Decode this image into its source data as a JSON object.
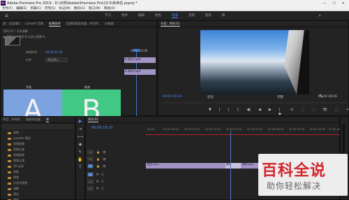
{
  "titlebar": {
    "app_icon": "Pr",
    "title": "Adobe Premiere Pro 2019 - D:\\示例\\Adobe\\Premiere Pro\\13.0\\未命名.prproj *",
    "controls": [
      "—",
      "☐",
      "✕"
    ]
  },
  "menubar": {
    "items": [
      "文件(F)",
      "编辑(E)",
      "剪辑(C)",
      "序列(S)",
      "标记(M)",
      "图形(G)",
      "窗口(W)",
      "帮助(H)"
    ]
  },
  "workspace": {
    "home_icon": "home-icon",
    "tabs": [
      "学习",
      "组件",
      "编辑",
      "颜色",
      "效果",
      "音频",
      "图形",
      "库"
    ],
    "active_tab": "效果",
    "more": "»"
  },
  "effect_panel": {
    "tabs": [
      "源：(无剪辑)",
      "Lumetri 范围",
      "效果控件",
      "音频剪辑混合器：序列01",
      "元数据"
    ],
    "active_tab": "效果控件",
    "crumb": "序列 01 * 交叉溶解",
    "hint": "▶ 图像 A 卷曲到 B 以显示图像 B。",
    "duration_label": "持续时间",
    "duration_value": "00:00:01:00",
    "align_label": "对齐",
    "align_value": "中心切入",
    "ruler_time": "00:00:20:00",
    "clip_top": "A 阳光.mp4",
    "clip_bottom": "B 海洋.mp4",
    "start_label": "开始",
    "end_label": "结束",
    "letter_a": "A",
    "letter_b": "B",
    "timecode": "00:00:19:10"
  },
  "program_monitor": {
    "tab": "节目：序列 01",
    "timecode_left": "00:00:19:10",
    "fit": "适合",
    "quality": "完整",
    "timecode_right": "00:00:28:06",
    "controls": [
      "▼",
      "|",
      "|",
      "{",
      "◀|",
      "◀",
      "▶",
      "|▶",
      "→|",
      "⬚",
      "⬚",
      "📷",
      "⬚",
      "+"
    ]
  },
  "project_panel": {
    "tabs": [
      "项目：未命名",
      "媒体浏览器",
      "库"
    ],
    "active_tab": "项目：未命名",
    "items": [
      {
        "icon": "folder-icon",
        "label": "效果"
      },
      {
        "icon": "folder-icon",
        "label": "Lumetri 预设"
      },
      {
        "icon": "folder-icon",
        "label": "音频效果"
      },
      {
        "icon": "folder-icon",
        "label": "音频过渡"
      },
      {
        "icon": "folder-icon",
        "label": "视频效果"
      },
      {
        "icon": "folder-icon",
        "label": "视频过渡"
      },
      {
        "icon": "folder-icon",
        "label": "3D 运动"
      },
      {
        "icon": "folder-icon",
        "label": "划像"
      },
      {
        "icon": "folder-icon",
        "label": "擦除"
      },
      {
        "icon": "folder-icon",
        "label": "沉浸式视频"
      },
      {
        "icon": "folder-icon",
        "label": "溶解"
      },
      {
        "icon": "folder-icon",
        "label": "滑动"
      },
      {
        "icon": "folder-icon",
        "label": "缩放"
      },
      {
        "icon": "film-icon",
        "label": "页面剥落"
      }
    ]
  },
  "tools": [
    "▶",
    "⇥",
    "⟷",
    "◆",
    "✎",
    "✋",
    "T"
  ],
  "timeline": {
    "tab": "序列 01",
    "timecode": "00:00:19:10",
    "ruler": [
      "00:00",
      "00:00:05:00",
      "00:00:10:00",
      "00:00:15:00",
      "00:00:20:00",
      "00:00:25:00",
      "00:00:30:00",
      "00:00:35:00",
      "00:00:40:00",
      "00:00:45:00"
    ],
    "video_tracks": [
      "V3",
      "V2",
      "V1"
    ],
    "audio_tracks": [
      "A1",
      "A2",
      "A3"
    ],
    "clip_a": "阳光.mp4",
    "transition": "翻页",
    "clip_b": "海洋.mp4"
  },
  "watermark": {
    "logo": "百科全说",
    "sub": "助你轻松解决"
  }
}
